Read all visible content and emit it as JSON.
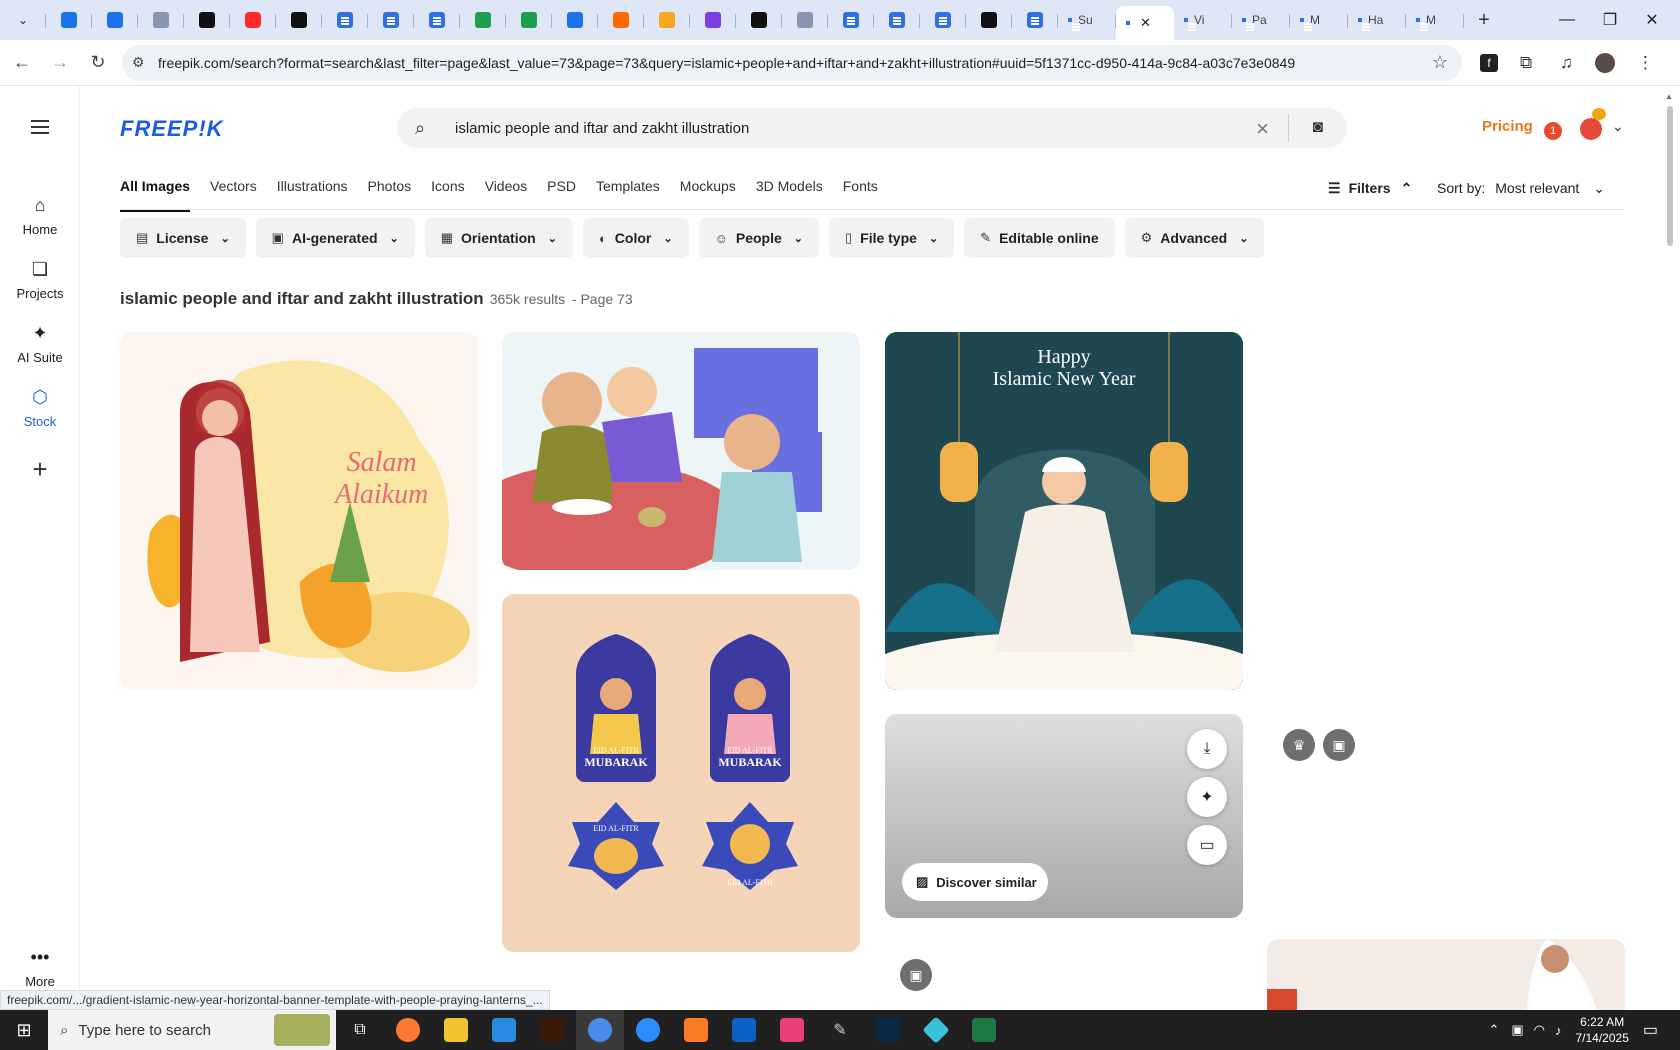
{
  "browser": {
    "active_tab_close": "✕",
    "labeled_tabs": [
      "Su",
      "Vi",
      "Pa",
      "M",
      "Ha",
      "M"
    ],
    "new_tab": "+",
    "url": "freepik.com/search?format=search&last_filter=page&last_value=73&page=73&query=islamic+people+and+iftar+and+zakht+illustration#uuid=5f1371cc-d950-414a-9c84-a03c7e3e0849",
    "status_url": "freepik.com/.../gradient-islamic-new-year-horizontal-banner-template-with-people-praying-lanterns_..."
  },
  "sidebar": {
    "items": [
      {
        "label": "Home",
        "icon": "home-icon"
      },
      {
        "label": "Projects",
        "icon": "projects-icon"
      },
      {
        "label": "AI Suite",
        "icon": "sparkle-icon"
      },
      {
        "label": "Stock",
        "icon": "stock-icon"
      }
    ],
    "add": "+",
    "more_label": "More"
  },
  "header": {
    "logo": "FREEP!K",
    "search_query": "islamic people and iftar and zakht illustration",
    "pricing": "Pricing",
    "notification_count": "1"
  },
  "tabs": [
    "All Images",
    "Vectors",
    "Illustrations",
    "Photos",
    "Icons",
    "Videos",
    "PSD",
    "Templates",
    "Mockups",
    "3D Models",
    "Fonts"
  ],
  "active_tab": "All Images",
  "filters_label": "Filters",
  "sort": {
    "label": "Sort by:",
    "value": "Most relevant"
  },
  "chips": [
    {
      "label": "License"
    },
    {
      "label": "AI-generated"
    },
    {
      "label": "Orientation"
    },
    {
      "label": "Color"
    },
    {
      "label": "People"
    },
    {
      "label": "File type"
    },
    {
      "label": "Editable online"
    },
    {
      "label": "Advanced"
    }
  ],
  "results": {
    "query": "islamic people and iftar and zakht illustration",
    "count": "365k results",
    "page": "- Page 73"
  },
  "images": {
    "card1_text": [
      "Salam",
      "Alaikum"
    ],
    "card3_text": [
      "Happy",
      "Islamic New Year"
    ],
    "card4_badges": [
      "EID AL-FITR",
      "MUBARAK",
      "EID AL-FITR",
      "MUBARAK",
      "EID AL-FITR",
      "EID AL-FITR"
    ]
  },
  "hover_card": {
    "discover_label": "Discover similar"
  },
  "taskbar": {
    "search_placeholder": "Type here to search",
    "time": "6:22 AM",
    "date": "7/14/2025"
  },
  "colors": {
    "brand": "#1c5de0",
    "pricing": "#e87a1e"
  }
}
